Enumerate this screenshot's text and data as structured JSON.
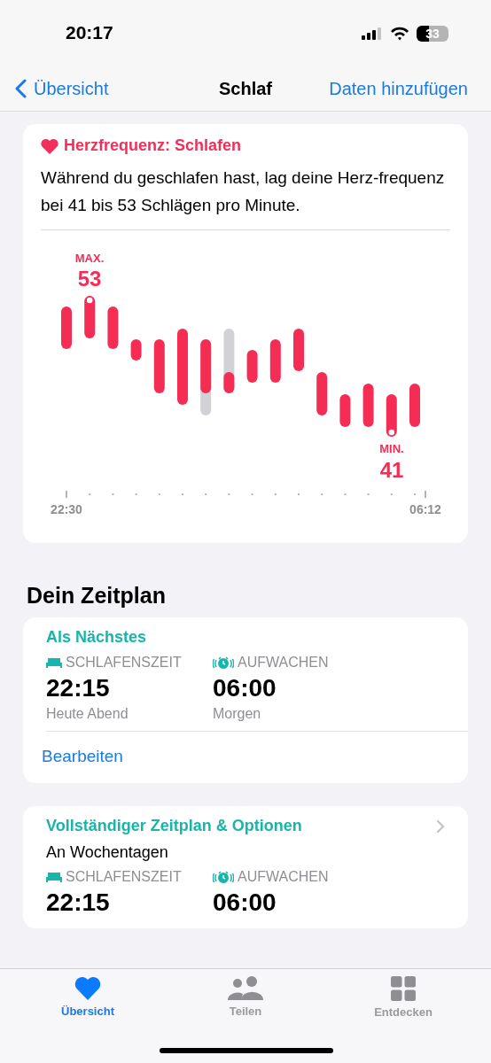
{
  "status_bar": {
    "time": "20:17",
    "battery": "33"
  },
  "nav": {
    "back": "Übersicht",
    "title": "Schlaf",
    "action": "Daten hinzufügen"
  },
  "heart_rate_card": {
    "title": "Herzfrequenz: Schlafen",
    "text": "Während du geschlafen hast, lag deine Herz-frequenz bei 41 bis 53 Schlägen pro Minute.",
    "chart": {
      "max_label": "MAX.",
      "max_value": "53",
      "min_label": "MIN.",
      "min_value": "41",
      "x_start": "22:30",
      "x_end": "06:12"
    }
  },
  "schedule": {
    "heading": "Dein Zeitplan",
    "next": {
      "title": "Als Nächstes",
      "edit": "Bearbeiten",
      "items": [
        {
          "kind": "bedtime",
          "label": "SCHLAFENSZEIT",
          "time": "22:15",
          "note": "Heute Abend"
        },
        {
          "kind": "wake",
          "label": "AUFWACHEN",
          "time": "06:00",
          "note": "Morgen"
        }
      ]
    },
    "full": {
      "title": "Vollständiger Zeitplan & Optionen",
      "subtitle": "An Wochentagen",
      "items": [
        {
          "kind": "bedtime",
          "label": "SCHLAFENSZEIT",
          "time": "22:15"
        },
        {
          "kind": "wake",
          "label": "AUFWACHEN",
          "time": "06:00"
        }
      ]
    }
  },
  "tabs": [
    {
      "kind": "heart",
      "label": "Übersicht",
      "selected": true
    },
    {
      "kind": "people",
      "label": "Teilen",
      "selected": false
    },
    {
      "kind": "grid",
      "label": "Entdecken",
      "selected": false
    }
  ]
}
